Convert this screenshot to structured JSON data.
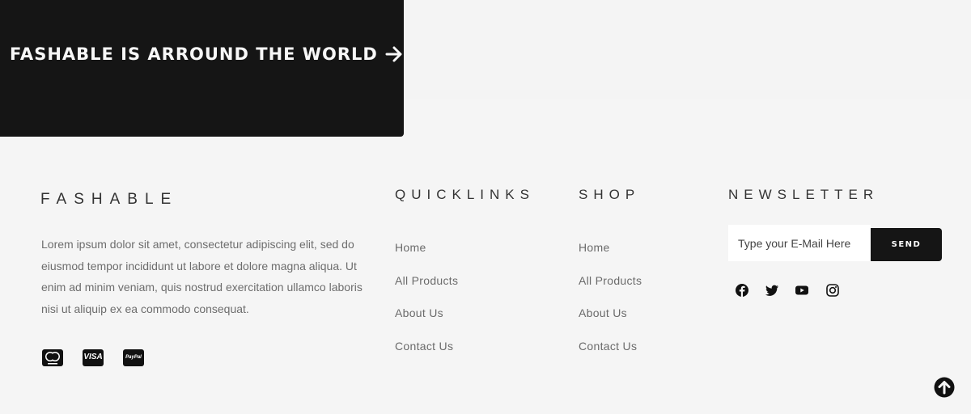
{
  "banner": {
    "title": "FASHABLE IS ARROUND THE WORLD",
    "arrow_icon": "arrow-right-icon"
  },
  "footer": {
    "brand": "FASHABLE",
    "about": "Lorem ipsum dolor sit amet, consectetur adipiscing elit, sed do eiusmod tempor incididunt ut labore et dolore magna aliqua. Ut enim ad minim veniam, quis nostrud exercitation ullamco laboris nisi ut aliquip ex ea commodo consequat.",
    "payments": [
      {
        "icon": "mastercard-icon"
      },
      {
        "icon": "visa-icon",
        "label": "VISA"
      },
      {
        "icon": "paypal-icon",
        "label": "PayPal"
      }
    ],
    "quicklinks": {
      "heading": "QUICKLINKS",
      "items": [
        "Home",
        "All Products",
        "About Us",
        "Contact Us"
      ]
    },
    "shop": {
      "heading": "SHOP",
      "items": [
        "Home",
        "All Products",
        "About Us",
        "Contact Us"
      ]
    },
    "newsletter": {
      "heading": "NEWSLETTER",
      "placeholder": "Type your E-Mail Here",
      "button": "SEND"
    },
    "social": [
      "facebook-icon",
      "twitter-icon",
      "youtube-icon",
      "instagram-icon"
    ],
    "scroll_top_icon": "arrow-up-circle-icon"
  },
  "colors": {
    "dark": "#151515",
    "background": "#f5f5f5",
    "text_muted": "#6d6d6d"
  }
}
